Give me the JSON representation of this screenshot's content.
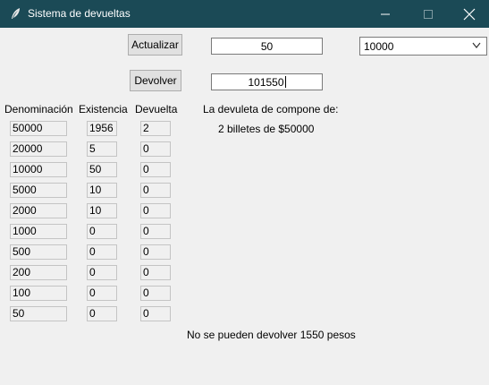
{
  "window": {
    "title": "Sistema de devueltas",
    "controls": {
      "minimize_icon": "minimize-icon",
      "maximize_icon": "maximize-icon",
      "close_icon": "close-icon"
    }
  },
  "controls": {
    "actualizar_label": "Actualizar",
    "devolver_label": "Devolver",
    "actualizar_value": "50",
    "devolver_value": "101550",
    "denomination_select": {
      "value": "10000"
    }
  },
  "headers": {
    "denominacion": "Denominación",
    "existencia": "Existencia",
    "devuelta": "Devuelta",
    "summary": "La devuleta de compone de:"
  },
  "rows": [
    {
      "denominacion": "50000",
      "existencia": "1956",
      "devuelta": "2"
    },
    {
      "denominacion": "20000",
      "existencia": "5",
      "devuelta": "0"
    },
    {
      "denominacion": "10000",
      "existencia": "50",
      "devuelta": "0"
    },
    {
      "denominacion": "5000",
      "existencia": "10",
      "devuelta": "0"
    },
    {
      "denominacion": "2000",
      "existencia": "10",
      "devuelta": "0"
    },
    {
      "denominacion": "1000",
      "existencia": "0",
      "devuelta": "0"
    },
    {
      "denominacion": "500",
      "existencia": "0",
      "devuelta": "0"
    },
    {
      "denominacion": "200",
      "existencia": "0",
      "devuelta": "0"
    },
    {
      "denominacion": "100",
      "existencia": "0",
      "devuelta": "0"
    },
    {
      "denominacion": "50",
      "existencia": "0",
      "devuelta": "0"
    }
  ],
  "summary": {
    "lines": [
      "2  billetes  de  $50000"
    ]
  },
  "status": {
    "message": "No se pueden devolver 1550 pesos"
  }
}
